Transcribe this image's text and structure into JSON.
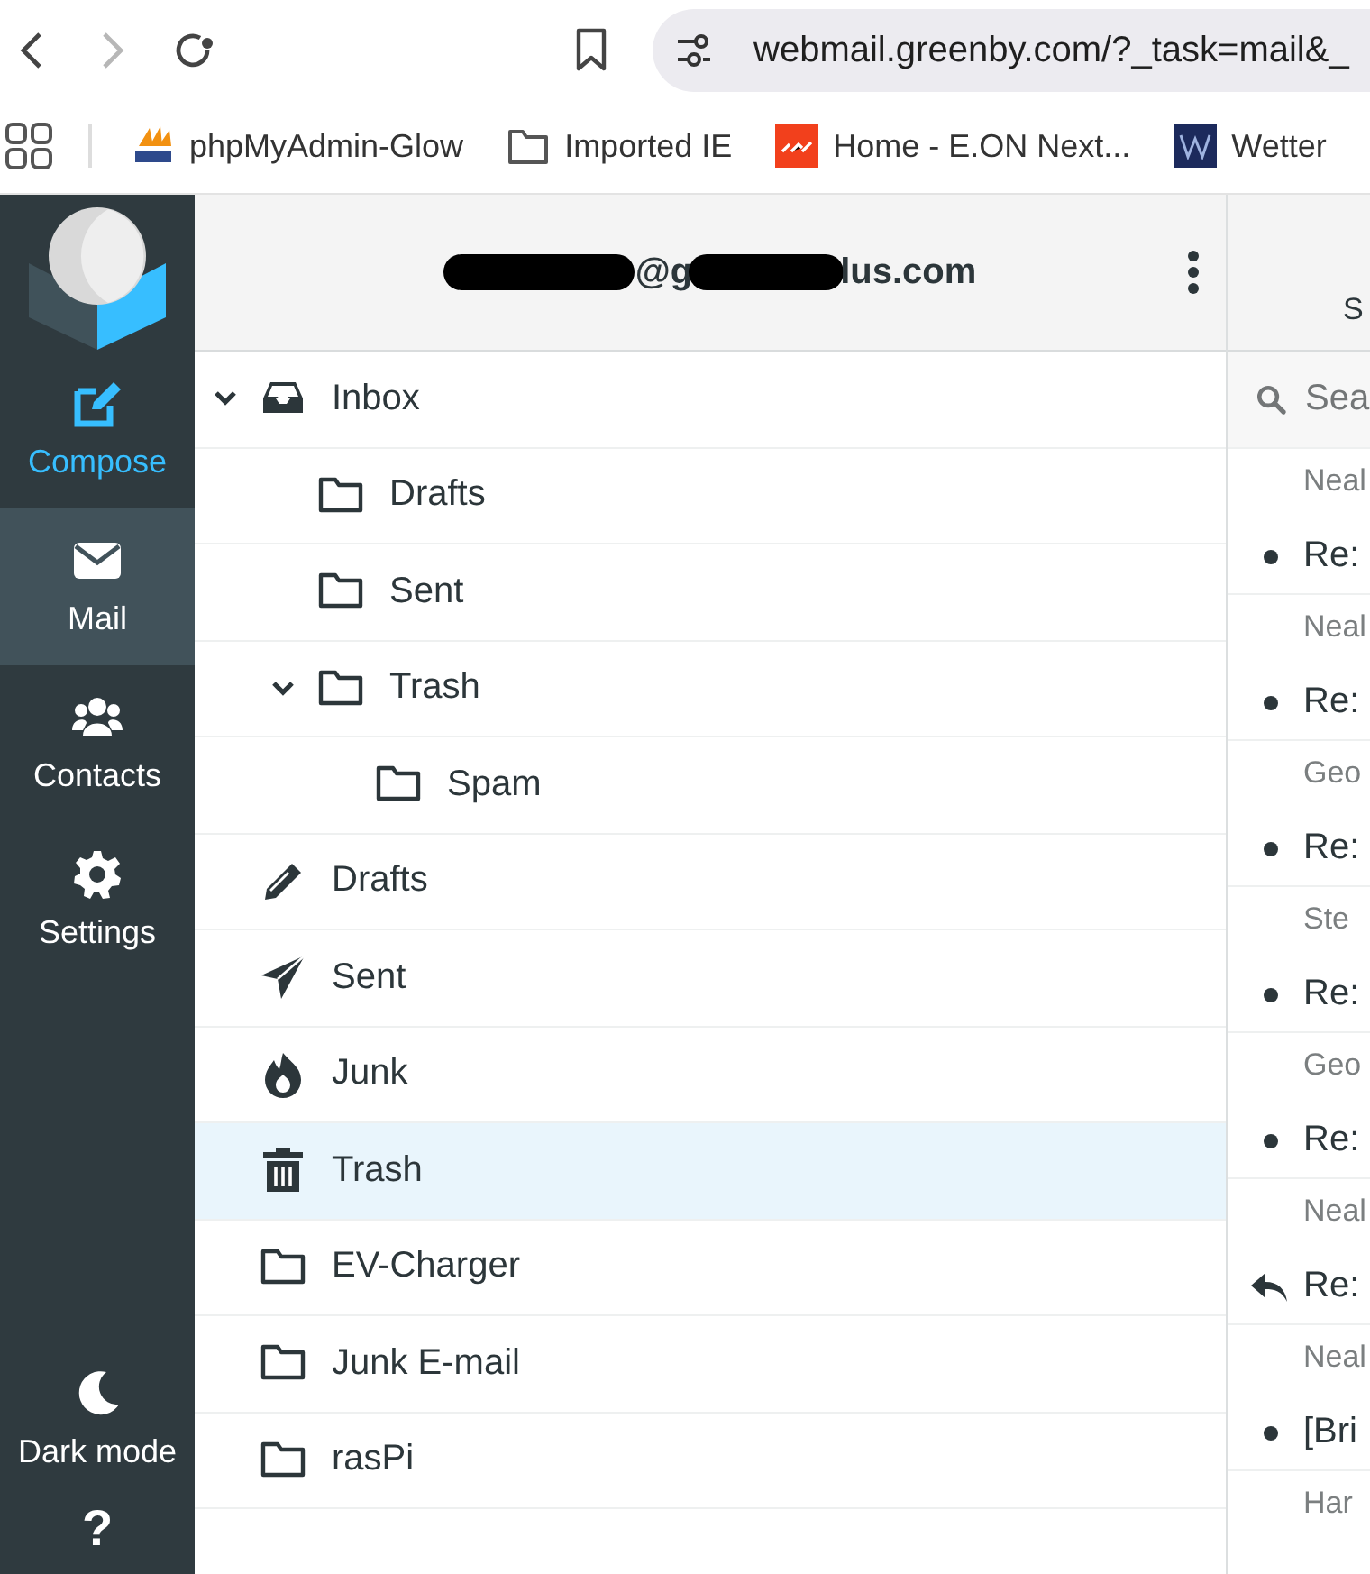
{
  "browser": {
    "back_disabled": false,
    "forward_disabled": true,
    "url": "webmail.greenby.com/?_task=mail&_",
    "bookmarks": [
      {
        "kind": "pma",
        "label": "phpMyAdmin-Glow"
      },
      {
        "kind": "folder",
        "label": "Imported IE"
      },
      {
        "kind": "next",
        "label": "Home - E.ON Next..."
      },
      {
        "kind": "w",
        "label": "Wetter"
      }
    ]
  },
  "nav": {
    "items": [
      {
        "kind": "compose",
        "label": "Compose",
        "selected": false
      },
      {
        "kind": "mail",
        "label": "Mail",
        "selected": true
      },
      {
        "kind": "contacts",
        "label": "Contacts",
        "selected": false
      },
      {
        "kind": "settings",
        "label": "Settings",
        "selected": false
      }
    ],
    "bottom": [
      {
        "kind": "darkmode",
        "label": "Dark mode"
      },
      {
        "kind": "help",
        "label": "?"
      }
    ]
  },
  "account": [
    {
      "kind": "redacted"
    },
    {
      "kind": "text",
      "text": "@g"
    },
    {
      "kind": "redacted"
    },
    {
      "kind": "text",
      "text": "lus.com"
    }
  ],
  "folders": [
    {
      "kind": "inbox",
      "label": "Inbox",
      "selected": false,
      "expanded": true,
      "children": [
        {
          "kind": "folder",
          "label": "Drafts",
          "selected": false
        },
        {
          "kind": "folder",
          "label": "Sent",
          "selected": false
        },
        {
          "kind": "folder",
          "label": "Trash",
          "selected": false,
          "expanded": true,
          "children": [
            {
              "kind": "folder",
              "label": "Spam",
              "selected": false
            }
          ]
        }
      ]
    },
    {
      "kind": "drafts",
      "label": "Drafts",
      "selected": false
    },
    {
      "kind": "sent",
      "label": "Sent",
      "selected": false
    },
    {
      "kind": "junk",
      "label": "Junk",
      "selected": false
    },
    {
      "kind": "trash",
      "label": "Trash",
      "selected": true
    },
    {
      "kind": "folder",
      "label": "EV-Charger",
      "selected": false
    },
    {
      "kind": "folder",
      "label": "Junk E-mail",
      "selected": false
    },
    {
      "kind": "folder",
      "label": "rasPi",
      "selected": false
    }
  ],
  "message_list": {
    "header": "S",
    "search": {
      "placeholder": "Sea"
    },
    "messages": [
      {
        "sender": "Neal",
        "subject": "Re:",
        "replied": false
      },
      {
        "sender": "Neal",
        "subject": "Re:",
        "replied": false
      },
      {
        "sender": "Geo",
        "subject": "Re:",
        "replied": false
      },
      {
        "sender": "Ste",
        "subject": "Re:",
        "replied": false
      },
      {
        "sender": "Geo",
        "subject": "Re:",
        "replied": false
      },
      {
        "sender": "Neal",
        "subject": "Re:",
        "replied": true
      },
      {
        "sender": "Neal",
        "subject": "[Bri",
        "replied": false
      },
      {
        "sender": "Har"
      }
    ]
  }
}
